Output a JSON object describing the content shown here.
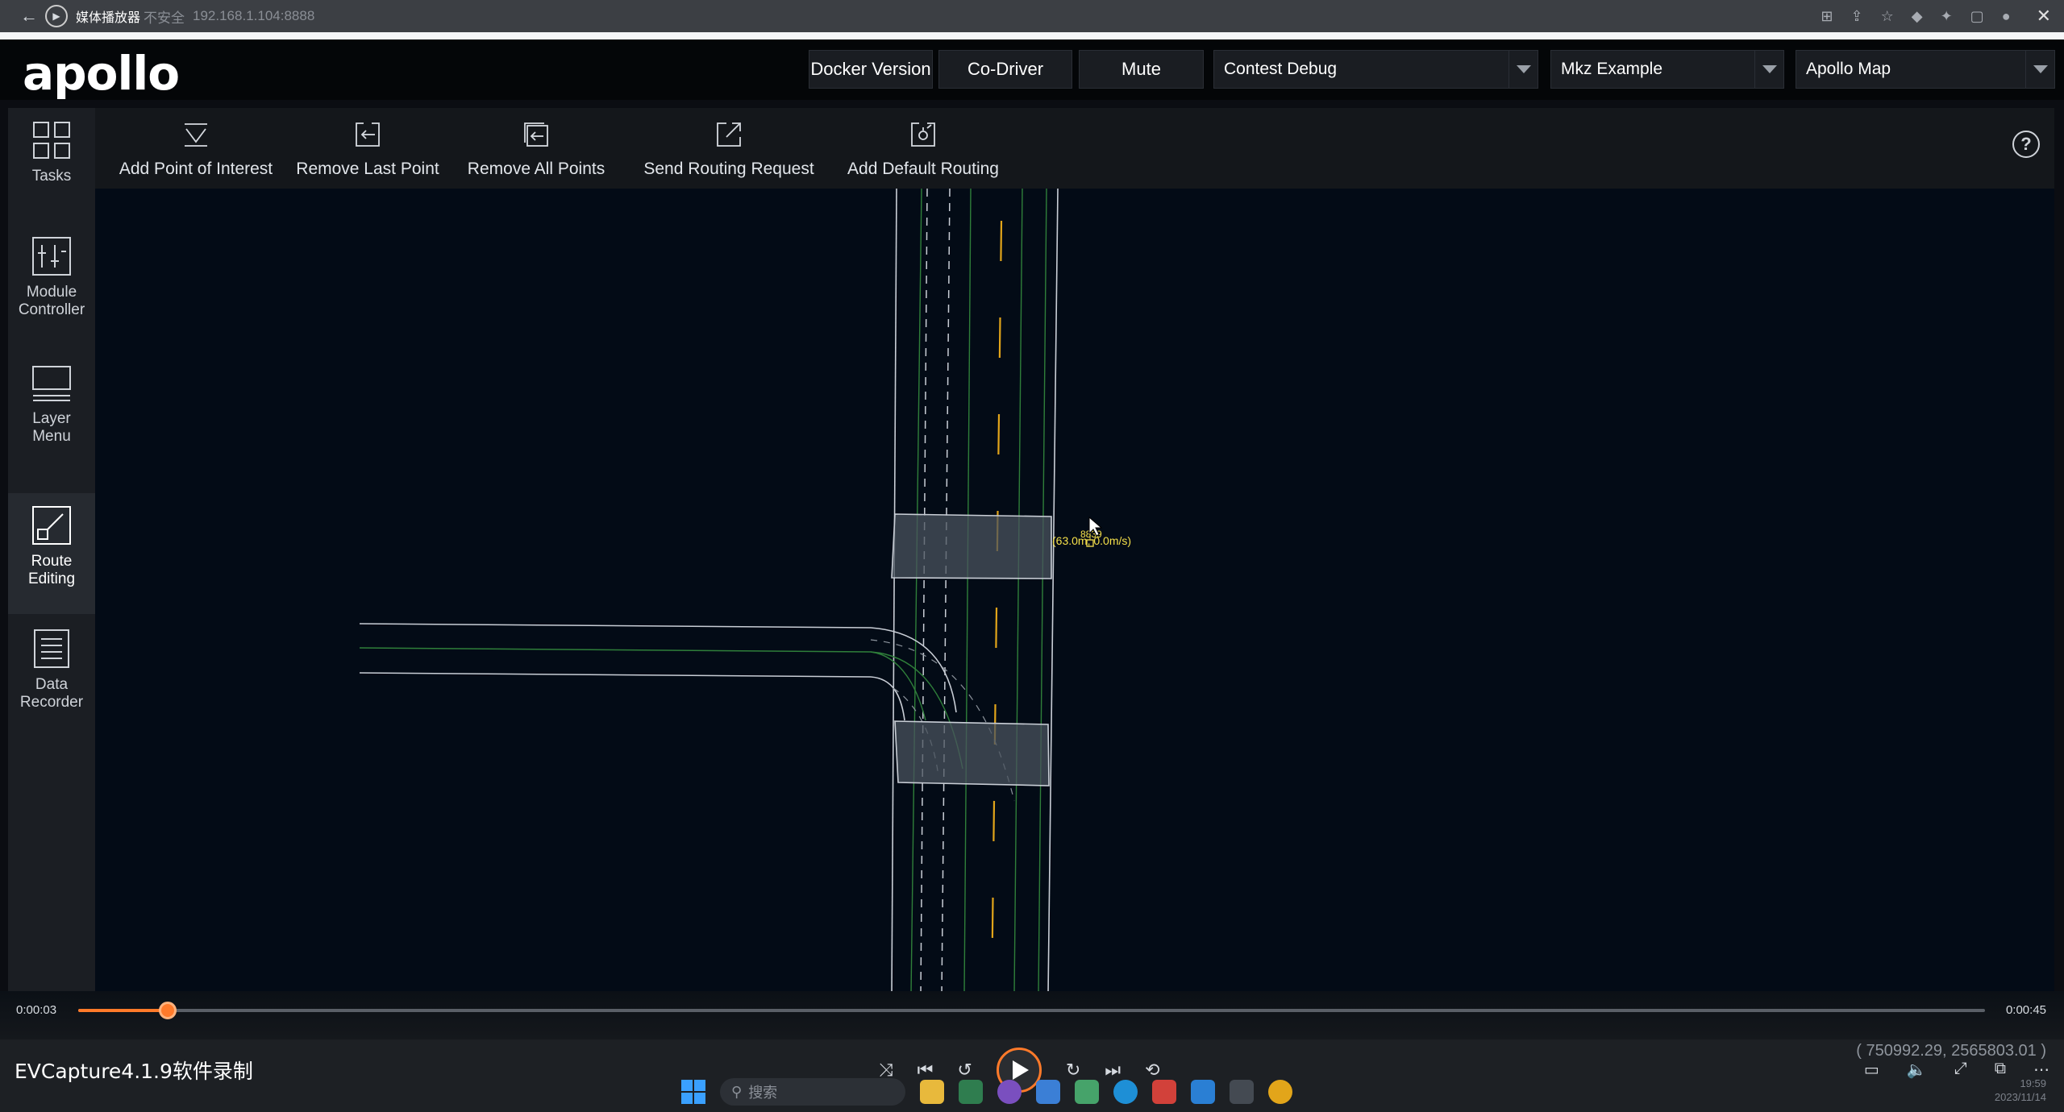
{
  "player": {
    "title": "媒体播放器",
    "insecure": "不安全",
    "url": "192.168.1.104:8888"
  },
  "header": {
    "logo": "apollo",
    "buttons": [
      "Docker Version",
      "Co-Driver",
      "Mute"
    ],
    "selects": {
      "mode": "Contest Debug",
      "vehicle": "Mkz Example",
      "map": "Apollo Map"
    }
  },
  "sidebar": {
    "items": [
      {
        "label": "Tasks",
        "icon": "grid-icon"
      },
      {
        "label": "Module\nController",
        "icon": "module-controller-icon"
      },
      {
        "label": "Layer\nMenu",
        "icon": "layer-menu-icon"
      },
      {
        "label": "Route\nEditing",
        "icon": "route-editing-icon",
        "active": true
      },
      {
        "label": "Data\nRecorder",
        "icon": "data-recorder-icon"
      }
    ]
  },
  "toolbar": {
    "tools": [
      {
        "label": "Add Point of Interest",
        "icon": "funnel-icon"
      },
      {
        "label": "Remove Last Point",
        "icon": "remove-last-icon"
      },
      {
        "label": "Remove All Points",
        "icon": "remove-all-icon"
      },
      {
        "label": "Send Routing Request",
        "icon": "send-icon"
      },
      {
        "label": "Add Default Routing",
        "icon": "default-routing-icon"
      }
    ],
    "help": "?"
  },
  "map": {
    "vehicle_label_line1": "8839",
    "vehicle_label_line2": "(63.0m, 0.0m/s)"
  },
  "playback": {
    "current_time": "0:00:03",
    "total_time": "0:00:45",
    "progress": 0.047,
    "recorder_watermark": "EVCapture4.1.9软件录制",
    "coordinates": "( 750992.29, 2565803.01 )",
    "search_placeholder": "搜索",
    "clock_time": "19:59",
    "clock_date": "2023/11/14"
  },
  "colors": {
    "accent": "#ff7a2a",
    "lane_green": "#3c8f3c",
    "lane_yellow": "#e2a51a",
    "crosswalk": "#505a66"
  }
}
